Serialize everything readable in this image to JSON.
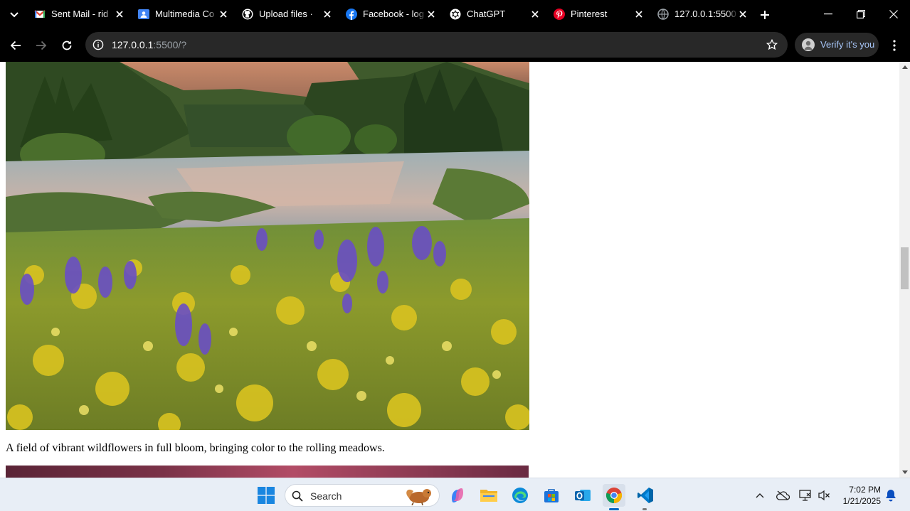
{
  "browser": {
    "tabs": [
      {
        "title": "Sent Mail - rid",
        "icon": "gmail-icon"
      },
      {
        "title": "Multimedia Co",
        "icon": "classroom-icon"
      },
      {
        "title": "Upload files · ",
        "icon": "github-icon"
      },
      {
        "title": "Facebook - log",
        "icon": "facebook-icon"
      },
      {
        "title": "ChatGPT",
        "icon": "chatgpt-icon"
      },
      {
        "title": "Pinterest",
        "icon": "pinterest-icon"
      },
      {
        "title": "127.0.0.1:5500",
        "icon": "globe-icon",
        "active": true
      }
    ],
    "url_host": "127.0.0.1",
    "url_rest": ":5500/?",
    "profile_label": "Verify it's you"
  },
  "page": {
    "caption": "A field of vibrant wildflowers in full bloom, bringing color to the rolling meadows."
  },
  "taskbar": {
    "search_placeholder": "Search",
    "apps": [
      "start-icon",
      "copilot-icon",
      "file-explorer-icon",
      "edge-icon",
      "microsoft-store-icon",
      "outlook-icon",
      "chrome-icon",
      "vscode-icon"
    ],
    "time": "7:02 PM",
    "date": "1/21/2025"
  },
  "colors": {
    "accent": "#0067c0",
    "omnibox": "#282828",
    "profile_text": "#a8c7fa"
  }
}
